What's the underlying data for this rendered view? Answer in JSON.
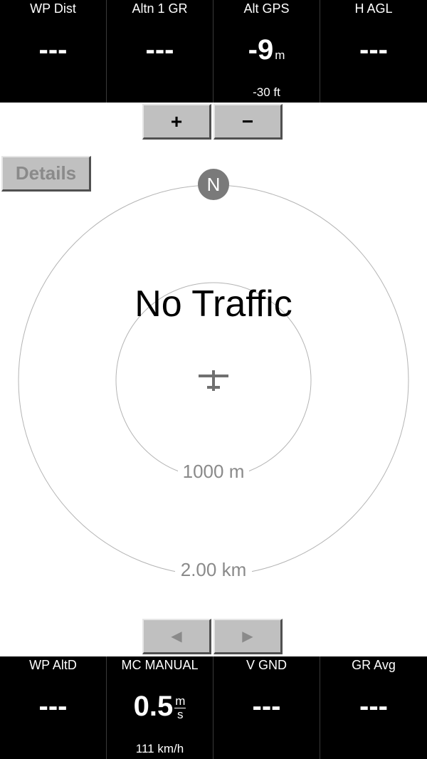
{
  "top_infoboxes": [
    {
      "title": "WP Dist",
      "value": "---",
      "unit": "",
      "comment": ""
    },
    {
      "title": "Altn 1 GR",
      "value": "---",
      "unit": "",
      "comment": ""
    },
    {
      "title": "Alt GPS",
      "value": "-9",
      "unit": "m",
      "comment": "-30 ft"
    },
    {
      "title": "H AGL",
      "value": "---",
      "unit": "",
      "comment": ""
    }
  ],
  "bottom_infoboxes": [
    {
      "title": "WP AltD",
      "value": "---",
      "unit": "",
      "comment": ""
    },
    {
      "title": "MC MANUAL",
      "value": "0.5",
      "unit_num": "m",
      "unit_den": "s",
      "comment": "111 km/h"
    },
    {
      "title": "V GND",
      "value": "---",
      "unit": "",
      "comment": ""
    },
    {
      "title": "GR Avg",
      "value": "---",
      "unit": "",
      "comment": ""
    }
  ],
  "zoom": {
    "in_label": "+",
    "out_label": "−"
  },
  "details_label": "Details",
  "radar": {
    "north_label": "N",
    "status_text": "No Traffic",
    "inner_ring_label": "1000 m",
    "outer_ring_label": "2.00 km"
  },
  "paging": {
    "prev_label": "◀",
    "next_label": "▶"
  },
  "colors": {
    "infobar_bg": "#000000",
    "button_face": "#c0c0c0",
    "north_badge": "#7a7a7a"
  }
}
